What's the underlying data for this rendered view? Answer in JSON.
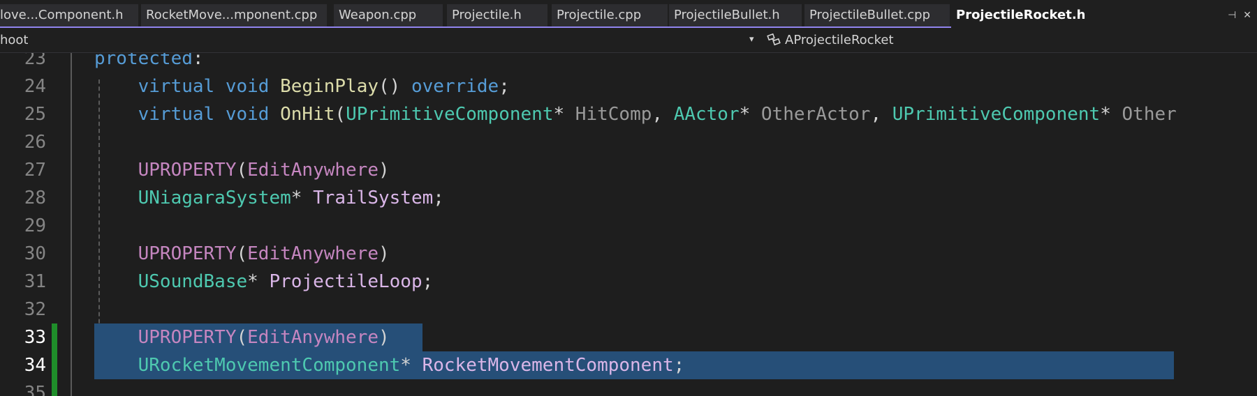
{
  "tabs": [
    {
      "label": "love...Component.h",
      "active": false
    },
    {
      "label": "RocketMove...mponent.cpp",
      "active": false
    },
    {
      "label": "Weapon.cpp",
      "active": false
    },
    {
      "label": "Projectile.h",
      "active": false
    },
    {
      "label": "Projectile.cpp",
      "active": false
    },
    {
      "label": "ProjectileBullet.h",
      "active": false
    },
    {
      "label": "ProjectileBullet.cpp",
      "active": false
    },
    {
      "label": "ProjectileRocket.h",
      "active": true
    }
  ],
  "tab_icons": {
    "pin": "pin-icon",
    "close": "close-icon",
    "pin_glyph": "⊣",
    "close_glyph": "✕"
  },
  "navigation": {
    "project": "hoot",
    "member": "AProjectileRocket",
    "member_icon": "class-icon"
  },
  "editor": {
    "lines": [
      {
        "number": "23",
        "tokens": [
          {
            "t": "protected",
            "c": "kw"
          },
          {
            "t": ":",
            "c": "pl"
          }
        ]
      },
      {
        "number": "24",
        "tokens": [
          {
            "t": "    virtual",
            "c": "kw"
          },
          {
            "t": " ",
            "c": "pl"
          },
          {
            "t": "void",
            "c": "kw"
          },
          {
            "t": " ",
            "c": "pl"
          },
          {
            "t": "BeginPlay",
            "c": "fn"
          },
          {
            "t": "() ",
            "c": "pl"
          },
          {
            "t": "override",
            "c": "kw"
          },
          {
            "t": ";",
            "c": "pl"
          }
        ]
      },
      {
        "number": "25",
        "tokens": [
          {
            "t": "    virtual",
            "c": "kw"
          },
          {
            "t": " ",
            "c": "pl"
          },
          {
            "t": "void",
            "c": "kw"
          },
          {
            "t": " ",
            "c": "pl"
          },
          {
            "t": "OnHit",
            "c": "fn"
          },
          {
            "t": "(",
            "c": "pl"
          },
          {
            "t": "UPrimitiveComponent",
            "c": "ty"
          },
          {
            "t": "* ",
            "c": "pl"
          },
          {
            "t": "HitComp",
            "c": "prm"
          },
          {
            "t": ", ",
            "c": "pl"
          },
          {
            "t": "AActor",
            "c": "ty"
          },
          {
            "t": "* ",
            "c": "pl"
          },
          {
            "t": "OtherActor",
            "c": "prm"
          },
          {
            "t": ", ",
            "c": "pl"
          },
          {
            "t": "UPrimitiveComponent",
            "c": "ty"
          },
          {
            "t": "* ",
            "c": "pl"
          },
          {
            "t": "Other",
            "c": "prm"
          }
        ]
      },
      {
        "number": "26",
        "tokens": []
      },
      {
        "number": "27",
        "tokens": [
          {
            "t": "    UPROPERTY",
            "c": "mac"
          },
          {
            "t": "(",
            "c": "pl"
          },
          {
            "t": "EditAnywhere",
            "c": "mac"
          },
          {
            "t": ")",
            "c": "pl"
          }
        ]
      },
      {
        "number": "28",
        "tokens": [
          {
            "t": "    UNiagaraSystem",
            "c": "ty"
          },
          {
            "t": "* ",
            "c": "pl"
          },
          {
            "t": "TrailSystem",
            "c": "mem"
          },
          {
            "t": ";",
            "c": "pl"
          }
        ]
      },
      {
        "number": "29",
        "tokens": []
      },
      {
        "number": "30",
        "tokens": [
          {
            "t": "    UPROPERTY",
            "c": "mac"
          },
          {
            "t": "(",
            "c": "pl"
          },
          {
            "t": "EditAnywhere",
            "c": "mac"
          },
          {
            "t": ")",
            "c": "pl"
          }
        ]
      },
      {
        "number": "31",
        "tokens": [
          {
            "t": "    USoundBase",
            "c": "ty"
          },
          {
            "t": "* ",
            "c": "pl"
          },
          {
            "t": "ProjectileLoop",
            "c": "mem"
          },
          {
            "t": ";",
            "c": "pl"
          }
        ]
      },
      {
        "number": "32",
        "tokens": []
      },
      {
        "number": "33",
        "tokens": [
          {
            "t": "    UPROPERTY",
            "c": "mac"
          },
          {
            "t": "(",
            "c": "pl"
          },
          {
            "t": "EditAnywhere",
            "c": "mac"
          },
          {
            "t": ")",
            "c": "pl"
          }
        ],
        "selected": true,
        "changed": true
      },
      {
        "number": "34",
        "tokens": [
          {
            "t": "    URocketMovementComponent",
            "c": "ty"
          },
          {
            "t": "* ",
            "c": "pl"
          },
          {
            "t": "RocketMovementComponent",
            "c": "mem"
          },
          {
            "t": ";",
            "c": "pl"
          }
        ],
        "selected": true,
        "changed": true
      },
      {
        "number": "35",
        "tokens": [],
        "changed": true
      }
    ]
  },
  "colors": {
    "background": "#1e1e1e",
    "accent": "#9184ee",
    "selection": "#264f78",
    "change_bar": "#1f8e2a"
  }
}
